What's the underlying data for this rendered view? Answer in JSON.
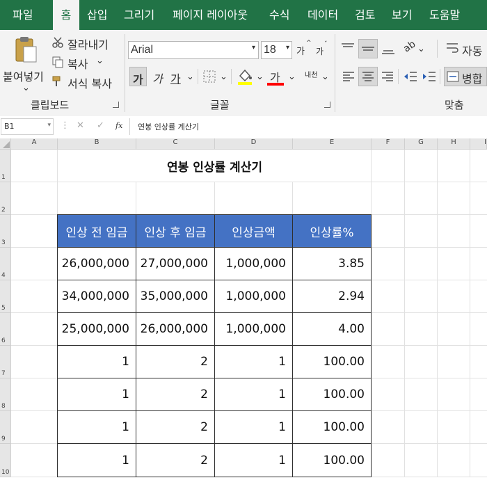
{
  "ribbon_tabs": [
    "파일",
    "홈",
    "삽입",
    "그리기",
    "페이지 레이아웃",
    "수식",
    "데이터",
    "검토",
    "보기",
    "도움말"
  ],
  "active_tab": "홈",
  "clipboard": {
    "paste_label": "붙여넣기",
    "cut_label": "잘라내기",
    "copy_label": "복사",
    "format_painter_label": "서식 복사",
    "group_label": "클립보드"
  },
  "font": {
    "font_name": "Arial",
    "font_size": "18",
    "bold_glyph": "가",
    "italic_glyph": "가",
    "underline_glyph": "가",
    "grow_glyph": "가",
    "shrink_glyph": "가",
    "font_color_glyph": "가",
    "phonetic_glyph": "내천",
    "group_label": "글꼴",
    "fill_color": "#ffff00",
    "font_color": "#ff0000"
  },
  "alignment": {
    "wrap_label": "자동",
    "merge_label": "병합",
    "group_label": "맞춤"
  },
  "formula_bar": {
    "name_box": "B1",
    "fx": "fx",
    "formula": "연봉 인상률 계산기"
  },
  "columns": [
    "A",
    "B",
    "C",
    "D",
    "E",
    "F",
    "G",
    "H",
    "I"
  ],
  "rows": [
    "1",
    "2",
    "3",
    "4",
    "5",
    "6",
    "7",
    "8",
    "9",
    "10"
  ],
  "sheet": {
    "title": "연봉 인상률 계산기",
    "header_color": "#4472c4",
    "headers": [
      "인상 전 임금",
      "인상 후 임금",
      "인상금액",
      "인상률%"
    ],
    "table_rows": [
      [
        "26,000,000",
        "27,000,000",
        "1,000,000",
        "3.85"
      ],
      [
        "34,000,000",
        "35,000,000",
        "1,000,000",
        "2.94"
      ],
      [
        "25,000,000",
        "26,000,000",
        "1,000,000",
        "4.00"
      ],
      [
        "1",
        "2",
        "1",
        "100.00"
      ],
      [
        "1",
        "2",
        "1",
        "100.00"
      ],
      [
        "1",
        "2",
        "1",
        "100.00"
      ],
      [
        "1",
        "2",
        "1",
        "100.00"
      ]
    ]
  }
}
